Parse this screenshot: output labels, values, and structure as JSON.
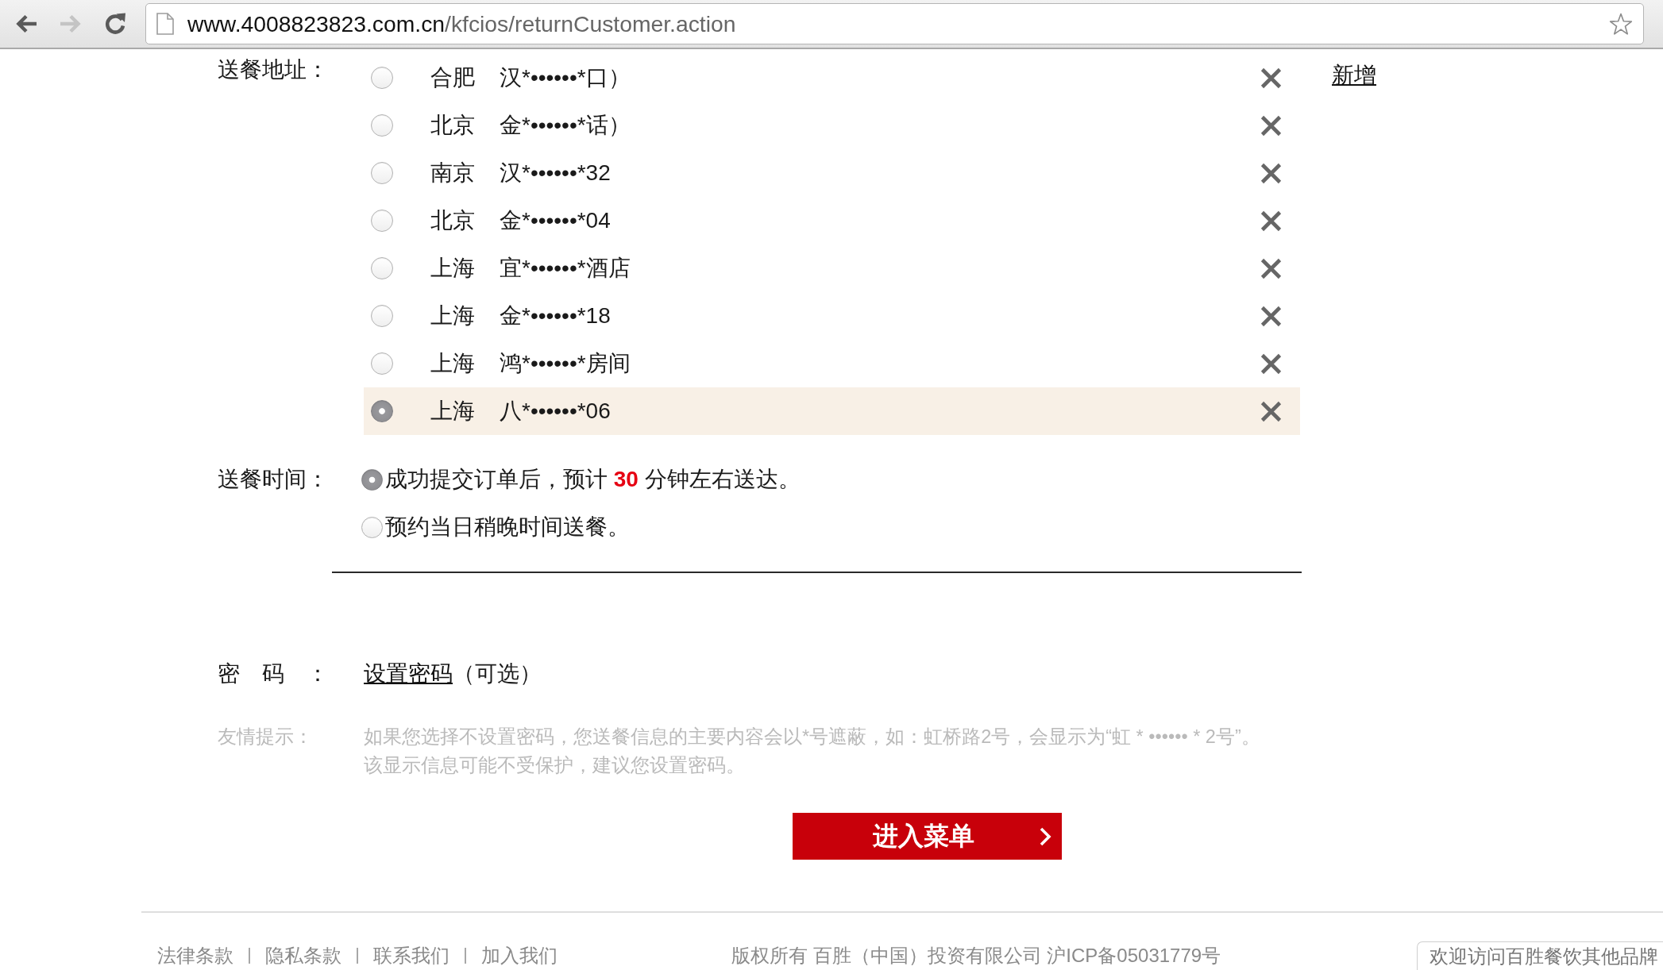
{
  "browser": {
    "nav_buttons": [
      {
        "kind": "back",
        "disabled": false
      },
      {
        "kind": "forward",
        "disabled": true
      },
      {
        "kind": "reload",
        "disabled": false
      }
    ],
    "url": {
      "host": "www.4008823823.com.cn",
      "path": "/kfcios/returnCustomer.action"
    }
  },
  "delivery_address": {
    "label": "送餐地址：",
    "addresses": [
      {
        "city": "合肥",
        "address": "汉*••••••*口）",
        "selected": false
      },
      {
        "city": "北京",
        "address": "金*••••••*话）",
        "selected": false
      },
      {
        "city": "南京",
        "address": "汉*••••••*32",
        "selected": false
      },
      {
        "city": "北京",
        "address": "金*••••••*04",
        "selected": false
      },
      {
        "city": "上海",
        "address": "宜*••••••*酒店",
        "selected": false
      },
      {
        "city": "上海",
        "address": "金*••••••*18",
        "selected": false
      },
      {
        "city": "上海",
        "address": "鸿*••••••*房间",
        "selected": false
      },
      {
        "city": "上海",
        "address": "八*••••••*06",
        "selected": true
      }
    ],
    "add_link": "新增"
  },
  "delivery_time": {
    "label": "送餐时间：",
    "options": [
      {
        "text": "成功提交订单后，预计 **30** 分钟左右送达。",
        "selected": true
      },
      {
        "text": "预约当日稍晚时间送餐。",
        "selected": false
      }
    ]
  },
  "password": {
    "label": "密　码　：",
    "link": "设置密码",
    "note": "（可选）"
  },
  "tip": {
    "label": "友情提示：",
    "lines": [
      "如果您选择不设置密码，您送餐信息的主要内容会以*号遮蔽，如：虹桥路2号，会显示为“虹 * •••••• * 2号”。",
      "该显示信息可能不受保护，建议您设置密码。"
    ]
  },
  "submit_button": {
    "label": "进入菜单"
  },
  "footer": {
    "links": [
      "法律条款",
      "隐私条款",
      "联系我们",
      "加入我们"
    ],
    "copyright": "版权所有 百胜（中国）投资有限公司 沪ICP备05031779号",
    "brands_button": "欢迎访问百胜餐饮其他品牌"
  }
}
